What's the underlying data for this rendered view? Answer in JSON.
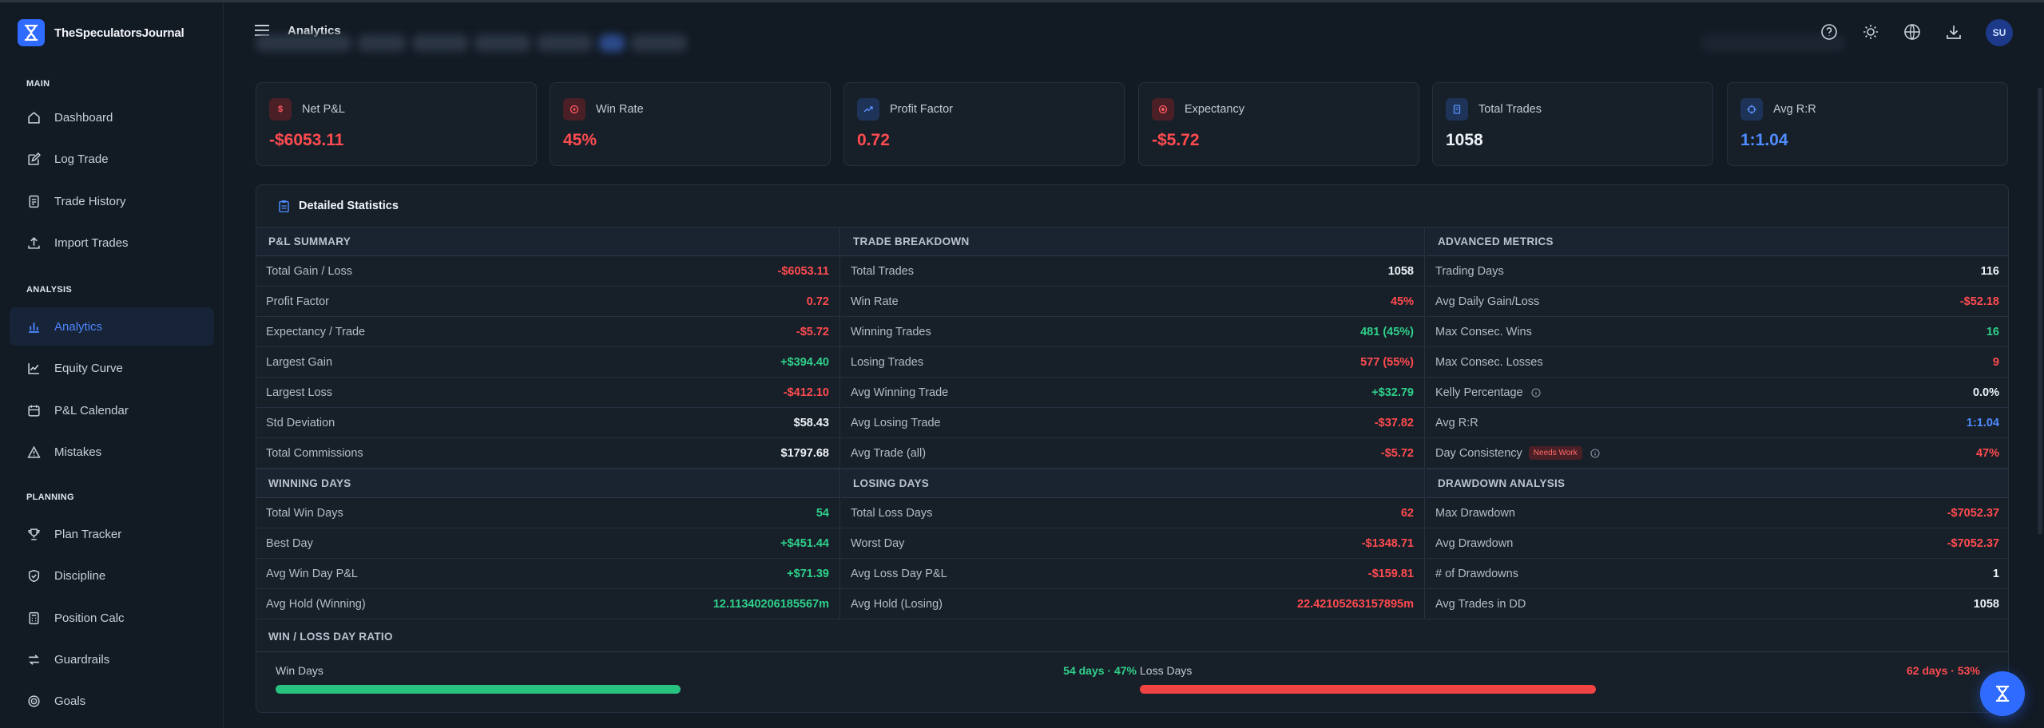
{
  "app": {
    "name": "TheSpeculatorsJournal"
  },
  "header": {
    "title": "Analytics",
    "avatar_initials": "SU"
  },
  "sidebar": {
    "sections": [
      {
        "title": "MAIN",
        "items": [
          {
            "label": "Dashboard",
            "icon": "home-icon"
          },
          {
            "label": "Log Trade",
            "icon": "edit-icon"
          },
          {
            "label": "Trade History",
            "icon": "history-icon"
          },
          {
            "label": "Import Trades",
            "icon": "upload-icon"
          }
        ]
      },
      {
        "title": "ANALYSIS",
        "items": [
          {
            "label": "Analytics",
            "icon": "bar-chart-icon",
            "active": true
          },
          {
            "label": "Equity Curve",
            "icon": "line-chart-icon"
          },
          {
            "label": "P&L Calendar",
            "icon": "calendar-icon"
          },
          {
            "label": "Mistakes",
            "icon": "warning-icon"
          }
        ]
      },
      {
        "title": "PLANNING",
        "items": [
          {
            "label": "Plan Tracker",
            "icon": "trophy-icon"
          },
          {
            "label": "Discipline",
            "icon": "shield-icon"
          },
          {
            "label": "Position Calc",
            "icon": "calculator-icon"
          },
          {
            "label": "Guardrails",
            "icon": "guardrails-icon"
          },
          {
            "label": "Goals",
            "icon": "target-icon"
          }
        ]
      }
    ]
  },
  "kpis": [
    {
      "label": "Net P&L",
      "value": "-$6053.11",
      "icon": "dollar-icon",
      "color": "#ff4b4f"
    },
    {
      "label": "Win Rate",
      "value": "45%",
      "icon": "target-icon",
      "color": "#ff4b4f"
    },
    {
      "label": "Profit Factor",
      "value": "0.72",
      "icon": "trend-icon",
      "color": "#ff4b4f"
    },
    {
      "label": "Expectancy",
      "value": "-$5.72",
      "icon": "circle-icon",
      "color": "#ff4b4f"
    },
    {
      "label": "Total Trades",
      "value": "1058",
      "icon": "document-icon",
      "color": "#eef2f7"
    },
    {
      "label": "Avg R:R",
      "value": "1:1.04",
      "icon": "crosshair-icon",
      "color": "#4f8cff"
    }
  ],
  "stats": {
    "title": "Detailed Statistics",
    "pnl_summary": {
      "title": "P&L SUMMARY",
      "rows": [
        {
          "label": "Total Gain / Loss",
          "value": "-$6053.11",
          "tone": "red"
        },
        {
          "label": "Profit Factor",
          "value": "0.72",
          "tone": "red"
        },
        {
          "label": "Expectancy / Trade",
          "value": "-$5.72",
          "tone": "red"
        },
        {
          "label": "Largest Gain",
          "value": "+$394.40",
          "tone": "green"
        },
        {
          "label": "Largest Loss",
          "value": "-$412.10",
          "tone": "red"
        },
        {
          "label": "Std Deviation",
          "value": "$58.43",
          "tone": "white"
        },
        {
          "label": "Total Commissions",
          "value": "$1797.68",
          "tone": "white"
        }
      ]
    },
    "trade_breakdown": {
      "title": "TRADE BREAKDOWN",
      "rows": [
        {
          "label": "Total Trades",
          "value": "1058",
          "tone": "white"
        },
        {
          "label": "Win Rate",
          "value": "45%",
          "tone": "red"
        },
        {
          "label": "Winning Trades",
          "value": "481 (45%)",
          "tone": "green"
        },
        {
          "label": "Losing Trades",
          "value": "577 (55%)",
          "tone": "red"
        },
        {
          "label": "Avg Winning Trade",
          "value": "+$32.79",
          "tone": "green"
        },
        {
          "label": "Avg Losing Trade",
          "value": "-$37.82",
          "tone": "red"
        },
        {
          "label": "Avg Trade (all)",
          "value": "-$5.72",
          "tone": "red"
        }
      ]
    },
    "advanced_metrics": {
      "title": "ADVANCED METRICS",
      "rows": [
        {
          "label": "Trading Days",
          "value": "116",
          "tone": "white"
        },
        {
          "label": "Avg Daily Gain/Loss",
          "value": "-$52.18",
          "tone": "red"
        },
        {
          "label": "Max Consec. Wins",
          "value": "16",
          "tone": "green"
        },
        {
          "label": "Max Consec. Losses",
          "value": "9",
          "tone": "red"
        },
        {
          "label": "Kelly Percentage",
          "value": "0.0%",
          "tone": "white",
          "info": true
        },
        {
          "label": "Avg R:R",
          "value": "1:1.04",
          "tone": "blue"
        },
        {
          "label": "Day Consistency",
          "value": "47%",
          "tone": "red",
          "badge": "Needs Work",
          "info": true
        }
      ]
    },
    "winning_days": {
      "title": "WINNING DAYS",
      "rows": [
        {
          "label": "Total Win Days",
          "value": "54",
          "tone": "green"
        },
        {
          "label": "Best Day",
          "value": "+$451.44",
          "tone": "green"
        },
        {
          "label": "Avg Win Day P&L",
          "value": "+$71.39",
          "tone": "green"
        },
        {
          "label": "Avg Hold (Winning)",
          "value": "12.11340206185567m",
          "tone": "green"
        }
      ]
    },
    "losing_days": {
      "title": "LOSING DAYS",
      "rows": [
        {
          "label": "Total Loss Days",
          "value": "62",
          "tone": "red"
        },
        {
          "label": "Worst Day",
          "value": "-$1348.71",
          "tone": "red"
        },
        {
          "label": "Avg Loss Day P&L",
          "value": "-$159.81",
          "tone": "red"
        },
        {
          "label": "Avg Hold (Losing)",
          "value": "22.42105263157895m",
          "tone": "red"
        }
      ]
    },
    "drawdown_analysis": {
      "title": "DRAWDOWN ANALYSIS",
      "rows": [
        {
          "label": "Max Drawdown",
          "value": "-$7052.37",
          "tone": "red"
        },
        {
          "label": "Avg Drawdown",
          "value": "-$7052.37",
          "tone": "red"
        },
        {
          "label": "# of Drawdowns",
          "value": "1",
          "tone": "white"
        },
        {
          "label": "Avg Trades in DD",
          "value": "1058",
          "tone": "white"
        }
      ]
    },
    "ratio": {
      "title": "WIN / LOSS DAY RATIO",
      "win_label": "Win Days",
      "win_text": "54 days · 47%",
      "win_fraction": 0.47,
      "loss_label": "Loss Days",
      "loss_text": "62 days · 53%",
      "loss_fraction": 0.53
    }
  }
}
